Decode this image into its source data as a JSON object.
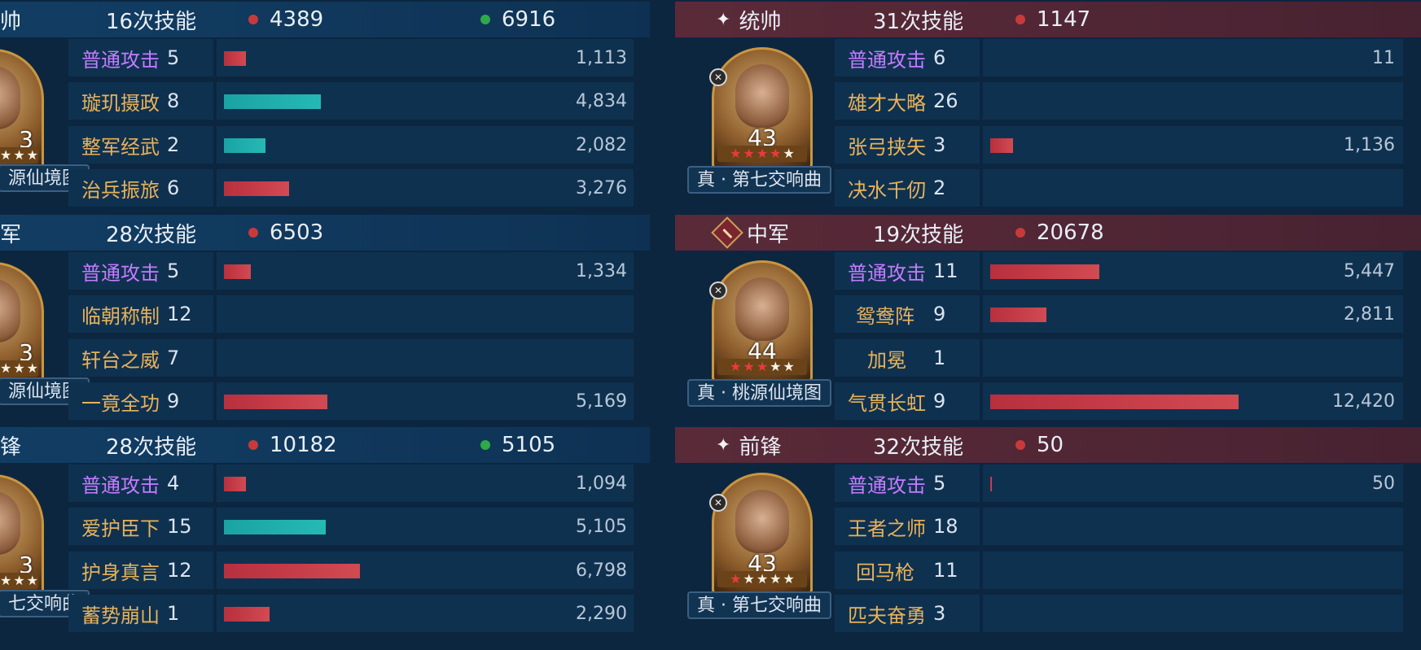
{
  "left": {
    "sections": [
      {
        "role": "帅",
        "casts": "16次技能",
        "damage": "4389",
        "heal": "6916",
        "formation": "源仙境图",
        "level": "3",
        "skills": [
          {
            "name": "普通攻击",
            "count": "5",
            "value": "1,113",
            "bar_pct": 0.036,
            "bar_color": "red",
            "normal": true
          },
          {
            "name": "璇玑摄政",
            "count": "8",
            "value": "4,834",
            "bar_pct": 0.158,
            "bar_color": "teal",
            "normal": false
          },
          {
            "name": "整军经武",
            "count": "2",
            "value": "2,082",
            "bar_pct": 0.068,
            "bar_color": "teal",
            "normal": false
          },
          {
            "name": "治兵振旅",
            "count": "6",
            "value": "3,276",
            "bar_pct": 0.107,
            "bar_color": "red",
            "normal": false
          }
        ]
      },
      {
        "role": "军",
        "casts": "28次技能",
        "damage": "6503",
        "heal": "",
        "formation": "源仙境图",
        "level": "3",
        "skills": [
          {
            "name": "普通攻击",
            "count": "5",
            "value": "1,334",
            "bar_pct": 0.044,
            "bar_color": "red",
            "normal": true
          },
          {
            "name": "临朝称制",
            "count": "12",
            "value": "",
            "bar_pct": 0,
            "bar_color": "red",
            "normal": false
          },
          {
            "name": "轩台之威",
            "count": "7",
            "value": "",
            "bar_pct": 0,
            "bar_color": "red",
            "normal": false
          },
          {
            "name": "一竟全功",
            "count": "9",
            "value": "5,169",
            "bar_pct": 0.169,
            "bar_color": "red",
            "normal": false
          }
        ]
      },
      {
        "role": "锋",
        "casts": "28次技能",
        "damage": "10182",
        "heal": "5105",
        "formation": "七交响曲",
        "level": "3",
        "skills": [
          {
            "name": "普通攻击",
            "count": "4",
            "value": "1,094",
            "bar_pct": 0.036,
            "bar_color": "red",
            "normal": true
          },
          {
            "name": "爱护臣下",
            "count": "15",
            "value": "5,105",
            "bar_pct": 0.167,
            "bar_color": "teal",
            "normal": false
          },
          {
            "name": "护身真言",
            "count": "12",
            "value": "6,798",
            "bar_pct": 0.222,
            "bar_color": "red",
            "normal": false
          },
          {
            "name": "蓄势崩山",
            "count": "1",
            "value": "2,290",
            "bar_pct": 0.075,
            "bar_color": "red",
            "normal": false
          }
        ]
      }
    ]
  },
  "right": {
    "sections": [
      {
        "role": "统帅",
        "icon": "sparkle-icon",
        "casts": "31次技能",
        "damage": "1147",
        "formation": "真 · 第七交响曲",
        "level": "43",
        "weapon_icon": "crossed-swords-icon",
        "stars": [
          "red",
          "red",
          "red",
          "red",
          "white"
        ],
        "skills": [
          {
            "name": "普通攻击",
            "count": "6",
            "value": "11",
            "bar_pct": 0,
            "bar_color": "red",
            "normal": true
          },
          {
            "name": "雄才大略",
            "count": "26",
            "value": "",
            "bar_pct": 0,
            "bar_color": "red",
            "normal": false
          },
          {
            "name": "张弓挟矢",
            "count": "3",
            "value": "1,136",
            "bar_pct": 0.037,
            "bar_color": "red",
            "normal": false
          },
          {
            "name": "决水千仞",
            "count": "2",
            "value": "",
            "bar_pct": 0,
            "bar_color": "red",
            "normal": false
          }
        ]
      },
      {
        "role": "中军",
        "icon": "banner-diamond-icon",
        "casts": "19次技能",
        "damage": "20678",
        "formation": "真 · 桃源仙境图",
        "level": "44",
        "weapon_icon": "spear-icon",
        "stars": [
          "red",
          "red",
          "red",
          "white",
          "white"
        ],
        "skills": [
          {
            "name": "普通攻击",
            "count": "11",
            "value": "5,447",
            "bar_pct": 0.178,
            "bar_color": "red",
            "normal": true
          },
          {
            "name": "鸳鸯阵",
            "count": "9",
            "value": "2,811",
            "bar_pct": 0.092,
            "bar_color": "red",
            "normal": false
          },
          {
            "name": "加冕",
            "count": "1",
            "value": "",
            "bar_pct": 0,
            "bar_color": "red",
            "normal": false
          },
          {
            "name": "气贯长虹",
            "count": "9",
            "value": "12,420",
            "bar_pct": 0.406,
            "bar_color": "red",
            "normal": false
          }
        ]
      },
      {
        "role": "前锋",
        "icon": "sparkle-icon",
        "casts": "32次技能",
        "damage": "50",
        "formation": "真 · 第七交响曲",
        "level": "43",
        "weapon_icon": "sword-icon",
        "stars": [
          "red",
          "white",
          "white",
          "white",
          "white"
        ],
        "skills": [
          {
            "name": "普通攻击",
            "count": "5",
            "value": "50",
            "bar_pct": 0.002,
            "bar_color": "red",
            "normal": true
          },
          {
            "name": "王者之师",
            "count": "18",
            "value": "",
            "bar_pct": 0,
            "bar_color": "red",
            "normal": false
          },
          {
            "name": "回马枪",
            "count": "11",
            "value": "",
            "bar_pct": 0,
            "bar_color": "red",
            "normal": false
          },
          {
            "name": "匹夫奋勇",
            "count": "3",
            "value": "",
            "bar_pct": 0,
            "bar_color": "red",
            "normal": false
          }
        ]
      }
    ]
  }
}
